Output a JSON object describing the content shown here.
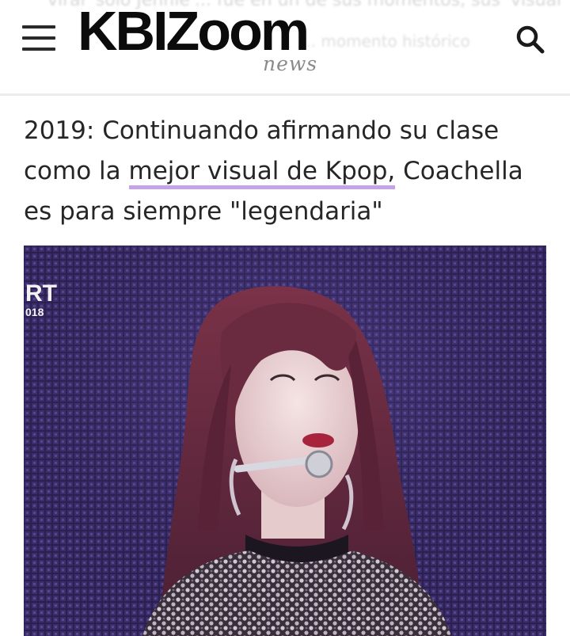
{
  "header": {
    "ghost_line_1": "viral 'solo Jennie'... fue en un de sus momentos, sus 'visual' habia",
    "ghost_line_2": "... momento histórico",
    "logo_main": "KBIZoom",
    "logo_sub": "news",
    "menu_icon": "hamburger-menu-icon",
    "search_icon": "search-icon"
  },
  "article": {
    "title_part_1": "2019: Continuando afirmando su clase",
    "title_part_2": "como la ",
    "title_highlight": "mejor visual de Kpop,",
    "title_part_3": " Coachella",
    "title_part_4": "es para siempre \"legendaria\"",
    "highlight_color": "#c4a3e9"
  },
  "hero_image": {
    "watermark_big": "RT",
    "watermark_small": "018"
  },
  "colors": {
    "text": "#262626",
    "logo": "#0b0b0b",
    "logo_sub": "#8a8a8a",
    "stage_bg": "#241a44"
  }
}
